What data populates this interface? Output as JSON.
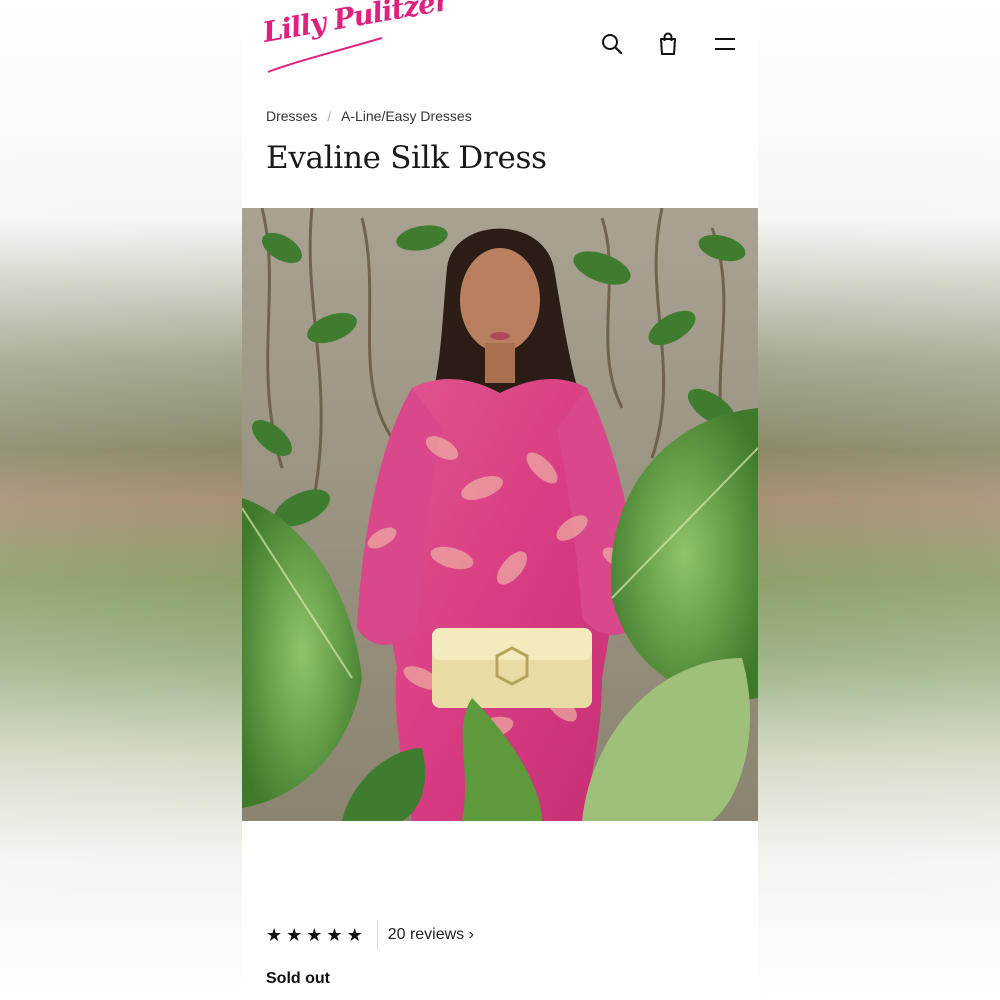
{
  "brand": {
    "logo_text": "Lilly Pulitzer",
    "logo_color": "#e0207e"
  },
  "header": {
    "search_icon": "search-icon",
    "bag_icon": "shopping-bag-icon",
    "menu_icon": "hamburger-menu-icon"
  },
  "breadcrumb": {
    "items": [
      "Dresses",
      "A-Line/Easy Dresses"
    ],
    "separator": "/"
  },
  "product": {
    "title": "Evaline Silk Dress",
    "image": "model-wearing-pink-metallic-floral-dress-holding-gold-clutch",
    "rating": 5,
    "star_glyph": "★",
    "reviews_label": "20 reviews ›",
    "availability": "Sold out"
  }
}
